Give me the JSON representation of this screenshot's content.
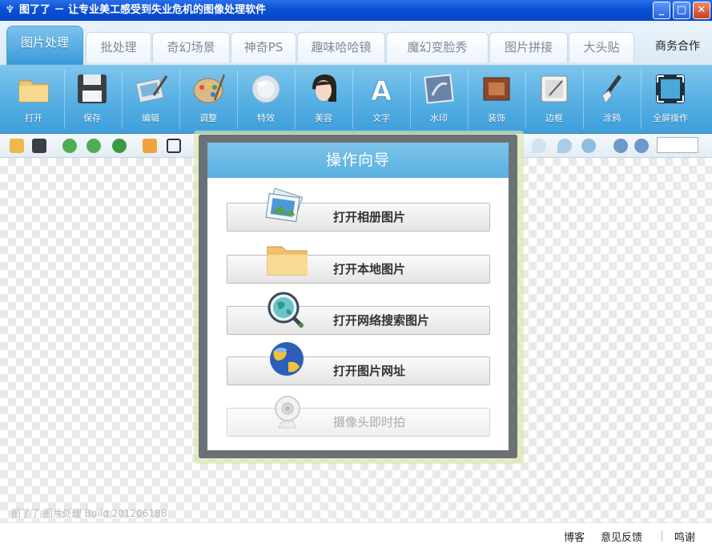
{
  "window": {
    "app_icon": "tuleile-icon",
    "title": "图了了 － 让专业美工感受到失业危机的图像处理软件",
    "controls": [
      "minimize-icon",
      "maximize-icon",
      "close-icon"
    ]
  },
  "tabs": [
    {
      "label": "图片处理",
      "active": true
    },
    {
      "label": "批处理",
      "active": false
    },
    {
      "label": "奇幻场景",
      "active": false
    },
    {
      "label": "神奇PS",
      "active": false
    },
    {
      "label": "趣味哈哈镜",
      "active": false
    },
    {
      "label": "魔幻变脸秀",
      "active": false
    },
    {
      "label": "图片拼接",
      "active": false
    },
    {
      "label": "大头贴",
      "active": false
    },
    {
      "label": "商务合作",
      "active": false
    }
  ],
  "toolbar": {
    "items": [
      {
        "label": "打开",
        "icon": "folder-icon"
      },
      {
        "label": "保存",
        "icon": "floppy-disk-icon"
      },
      {
        "label": "编辑",
        "icon": "edit-photo-icon"
      },
      {
        "label": "调整",
        "icon": "palette-icon"
      },
      {
        "label": "特效",
        "icon": "effects-orb-icon"
      },
      {
        "label": "美容",
        "icon": "face-beauty-icon"
      },
      {
        "label": "文字",
        "icon": "text-a-icon"
      },
      {
        "label": "水印",
        "icon": "watermark-icon"
      },
      {
        "label": "装饰",
        "icon": "decoration-icon"
      },
      {
        "label": "边框",
        "icon": "frame-icon"
      },
      {
        "label": "涂鸦",
        "icon": "brush-icon"
      },
      {
        "label": "全屏操作",
        "icon": "fullscreen-icon"
      }
    ]
  },
  "smallbar": {
    "left_icons": [
      "open-folder-small-icon",
      "save-small-icon",
      "undo-icon",
      "redo-icon",
      "refresh-icon",
      "resize-icon",
      "crop-icon"
    ],
    "right_icons": [
      "drop-light-icon",
      "drop-icon",
      "circle-icon",
      "zoom-in-icon",
      "zoom-out-icon"
    ],
    "zoom_value": ""
  },
  "dialog": {
    "title": "操作向导",
    "options": [
      {
        "label": "打开相册图片",
        "icon": "photo-album-icon",
        "enabled": true
      },
      {
        "label": "打开本地图片",
        "icon": "local-folder-icon",
        "enabled": true
      },
      {
        "label": "打开网络搜索图片",
        "icon": "web-search-globe-icon",
        "enabled": true
      },
      {
        "label": "打开图片网址",
        "icon": "globe-url-icon",
        "enabled": true
      },
      {
        "label": "摄像头即时拍",
        "icon": "webcam-icon",
        "enabled": false
      }
    ]
  },
  "canvas": {
    "watermark": "图了了 图片处理 Build 20120618B"
  },
  "statusbar": {
    "links": [
      "博客",
      "意见反馈",
      "鸣谢"
    ]
  },
  "colors": {
    "titlebar": "#0a4fd4",
    "toolbar": "#55afe3",
    "dialog_header": "#66b8e4",
    "dialog_frame": "#6a7277"
  }
}
